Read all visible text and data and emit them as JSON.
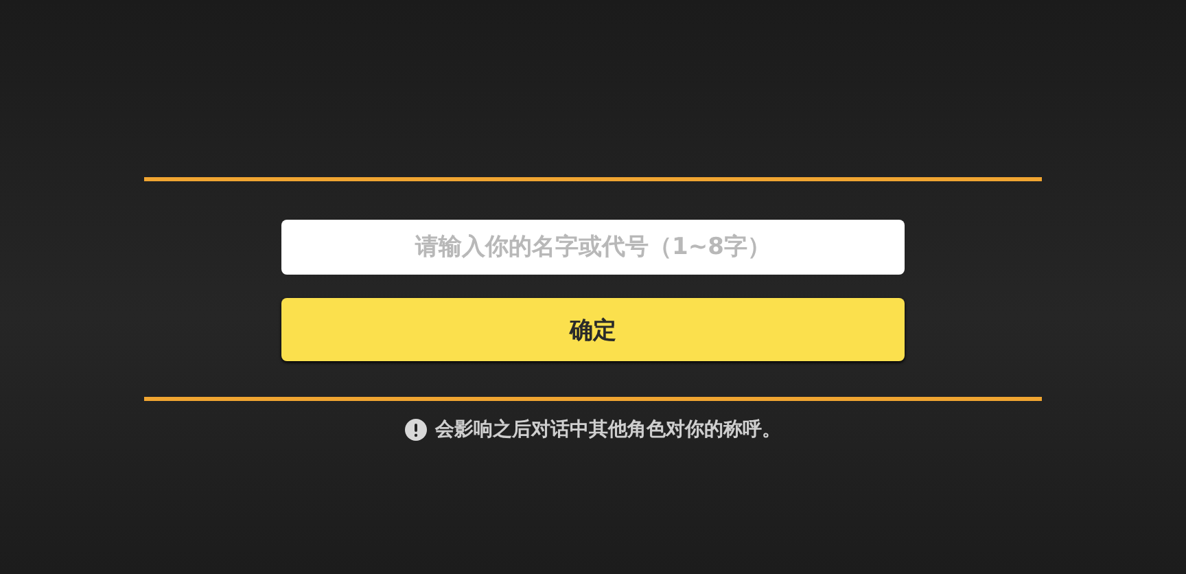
{
  "name_field": {
    "placeholder": "请输入你的名字或代号（1~8字）"
  },
  "confirm_button": {
    "label": "确定"
  },
  "notice": {
    "text": "会影响之后对话中其他角色对你的称呼。"
  }
}
